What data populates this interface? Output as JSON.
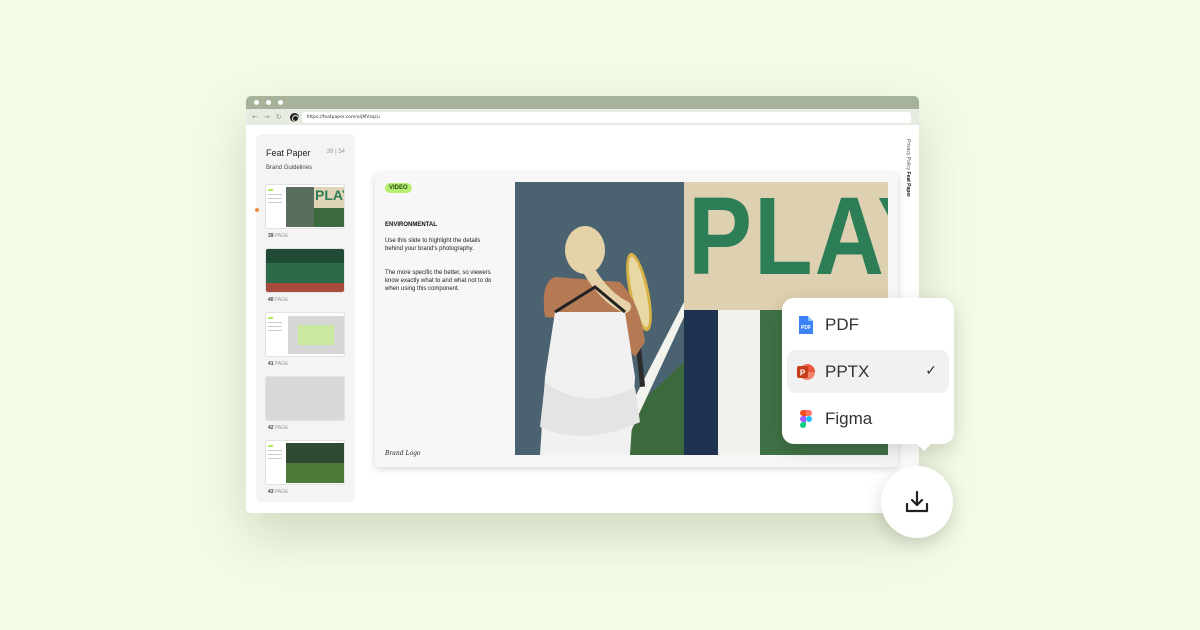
{
  "browser": {
    "url": "https://featpaper.com/e/jMVzqcu",
    "nav": {
      "back": "←",
      "forward": "→",
      "reload": "↻"
    }
  },
  "sidebar": {
    "title": "Feat Paper",
    "page_count": "39 | 54",
    "subtitle": "Brand Guidelines",
    "page_word": "PAGE",
    "thumbnails": [
      {
        "number": "39",
        "active": true
      },
      {
        "number": "40",
        "active": false
      },
      {
        "number": "41",
        "active": false
      },
      {
        "number": "42",
        "active": false
      },
      {
        "number": "43",
        "active": false
      }
    ]
  },
  "slide": {
    "badge": "VIDEO",
    "heading": "ENVIRONMENTAL",
    "paragraph1": "Use this slide to highlight the details behind your brand's photography.",
    "paragraph2": "The more specific the better, so viewers know exactly what to and what not to do when using this component.",
    "logo_text": "Brand Logo",
    "photo_text": "PLAY"
  },
  "side_credits": {
    "policy": "Privacy Policy",
    "brand": "Feat Paper"
  },
  "export_menu": {
    "options": [
      {
        "label": "PDF",
        "icon": "pdf-file-icon",
        "selected": false
      },
      {
        "label": "PPTX",
        "icon": "powerpoint-icon",
        "selected": true
      },
      {
        "label": "Figma",
        "icon": "figma-icon",
        "selected": false
      }
    ],
    "check_glyph": "✓"
  },
  "download_button": {
    "icon": "download-icon"
  },
  "colors": {
    "background": "#f3fbe6",
    "titlebar": "#a6b299",
    "badge": "#b7ef72",
    "active_dot": "#f08a3c",
    "play_green": "#2d7e57"
  }
}
